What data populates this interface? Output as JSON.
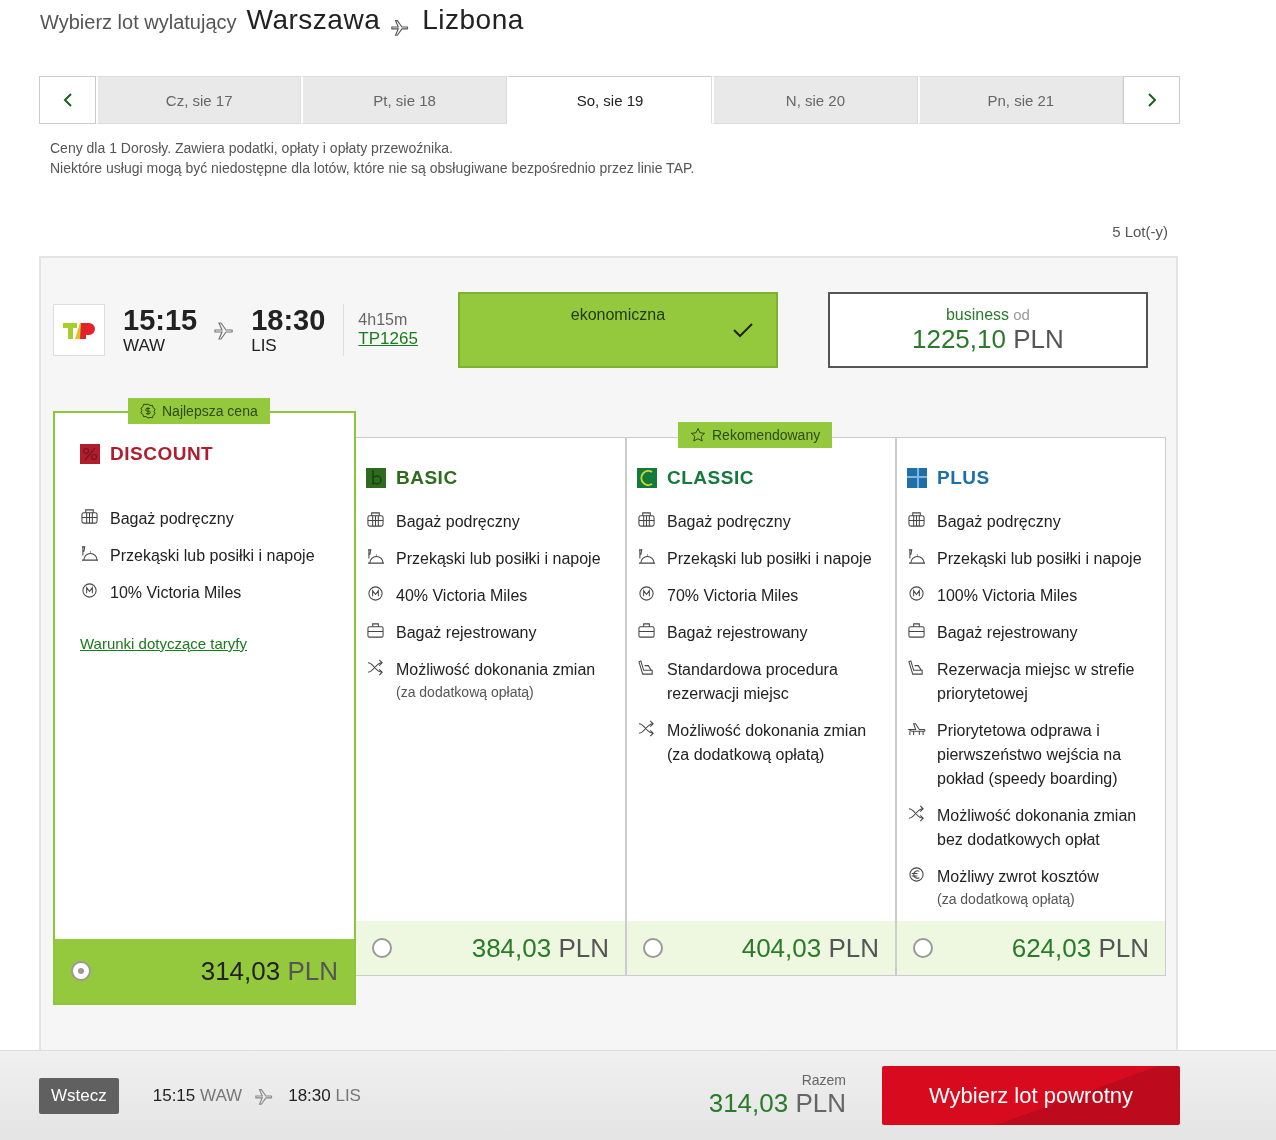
{
  "header": {
    "prefix": "Wybierz lot wylatujący",
    "origin": "Warszawa",
    "destination": "Lizbona"
  },
  "dates": [
    {
      "label": "Cz, sie 17",
      "selected": false
    },
    {
      "label": "Pt, sie 18",
      "selected": false
    },
    {
      "label": "So, sie 19",
      "selected": true
    },
    {
      "label": "N, sie 20",
      "selected": false
    },
    {
      "label": "Pn, sie 21",
      "selected": false
    }
  ],
  "notes": [
    "Ceny dla 1 Dorosły. Zawiera podatki, opłaty i opłaty przewoźnika.",
    "Niektóre usługi mogą być niedostępne dla lotów, które nie są obsługiwane bezpośrednio przez linie TAP."
  ],
  "flight_count": "5 Lot(-y)",
  "flight": {
    "departure_time": "15:15",
    "departure_airport": "WAW",
    "arrival_time": "18:30",
    "arrival_airport": "LIS",
    "duration": "4h15m",
    "flight_number": "TP1265"
  },
  "cabins": [
    {
      "label": "ekonomiczna",
      "selected": true
    },
    {
      "label": "business",
      "from_label": "od",
      "price": "1225,10",
      "currency": "PLN",
      "selected": false
    }
  ],
  "fares": [
    {
      "name": "DISCOUNT",
      "kind": "discount",
      "color": "#b01e2d",
      "badge": {
        "kind": "price",
        "label": "Najlepsza cena"
      },
      "selected": true,
      "price": "314,03",
      "currency": "PLN",
      "link": "Warunki dotyczące taryfy",
      "features": [
        {
          "kind": "bag",
          "text": "Bagaż podręczny"
        },
        {
          "kind": "meal",
          "text": "Przekąski lub posiłki i napoje"
        },
        {
          "kind": "miles",
          "text": "10% Victoria Miles"
        }
      ]
    },
    {
      "name": "BASIC",
      "kind": "basic",
      "color": "#2e6b1f",
      "selected": false,
      "price": "384,03",
      "currency": "PLN",
      "features": [
        {
          "kind": "bag",
          "text": "Bagaż podręczny"
        },
        {
          "kind": "meal",
          "text": "Przekąski lub posiłki i napoje"
        },
        {
          "kind": "miles",
          "text": "40% Victoria Miles"
        },
        {
          "kind": "suitcase",
          "text": "Bagaż rejestrowany"
        },
        {
          "kind": "change",
          "text": "Możliwość dokonania zmian",
          "note": "(za dodatkową opłatą)"
        }
      ]
    },
    {
      "name": "CLASSIC",
      "kind": "classic",
      "color": "#137a3a",
      "badge": {
        "kind": "star",
        "label": "Rekomendowany"
      },
      "selected": false,
      "price": "404,03",
      "currency": "PLN",
      "features": [
        {
          "kind": "bag",
          "text": "Bagaż podręczny"
        },
        {
          "kind": "meal",
          "text": "Przekąski lub posiłki i napoje"
        },
        {
          "kind": "miles",
          "text": "70% Victoria Miles"
        },
        {
          "kind": "suitcase",
          "text": "Bagaż rejestrowany"
        },
        {
          "kind": "seat",
          "text": "Standardowa procedura rezerwacji miejsc"
        },
        {
          "kind": "change",
          "text": "Możliwość dokonania zmian (za dodatkową opłatą)"
        }
      ]
    },
    {
      "name": "PLUS",
      "kind": "plus",
      "color": "#1f6fa8",
      "selected": false,
      "price": "624,03",
      "currency": "PLN",
      "features": [
        {
          "kind": "bag",
          "text": "Bagaż podręczny"
        },
        {
          "kind": "meal",
          "text": "Przekąski lub posiłki i napoje"
        },
        {
          "kind": "miles",
          "text": "100% Victoria Miles"
        },
        {
          "kind": "suitcase",
          "text": "Bagaż rejestrowany"
        },
        {
          "kind": "seat",
          "text": "Rezerwacja miejsc w strefie priorytetowej"
        },
        {
          "kind": "priority",
          "text": "Priorytetowa odprawa i pierwszeństwo wejścia na pokład (speedy boarding)"
        },
        {
          "kind": "change",
          "text": "Możliwość dokonania zmian bez dodatkowych opłat"
        },
        {
          "kind": "refund",
          "text": "Możliwy zwrot kosztów",
          "note": "(za dodatkową opłatą)"
        }
      ]
    }
  ],
  "footer": {
    "back": "Wstecz",
    "departure_time": "15:15",
    "departure_airport": "WAW",
    "arrival_time": "18:30",
    "arrival_airport": "LIS",
    "total_label": "Razem",
    "total": "314,03",
    "currency": "PLN",
    "continue": "Wybierz lot powrotny"
  }
}
